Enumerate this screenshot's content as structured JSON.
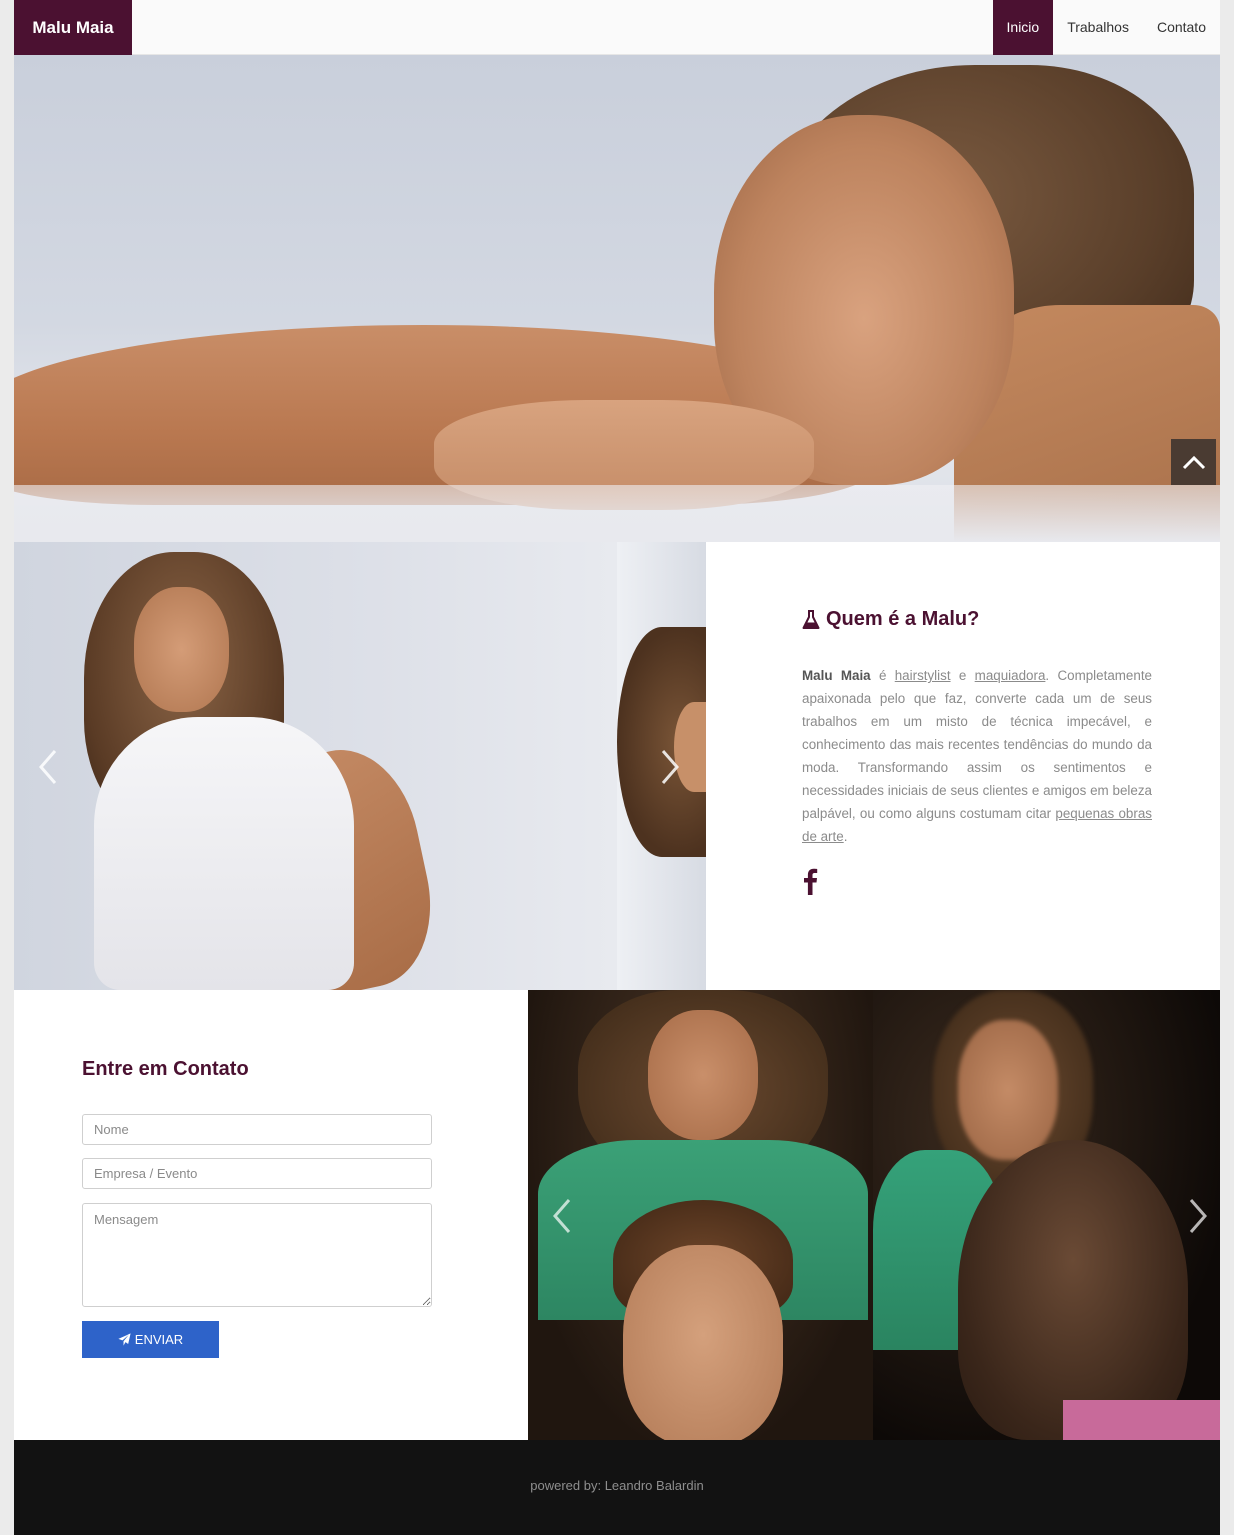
{
  "nav": {
    "brand": "Malu Maia",
    "links": [
      {
        "label": "Inicio",
        "active": true
      },
      {
        "label": "Trabalhos",
        "active": false
      },
      {
        "label": "Contato",
        "active": false
      }
    ]
  },
  "hero": {
    "scroll_top_icon": "chevron-up-icon"
  },
  "about": {
    "title": "Quem é a Malu?",
    "title_icon": "flask-icon",
    "name": "Malu Maia",
    "text_1": " é ",
    "link_hairstylist": "hairstylist",
    "text_2": " e ",
    "link_maquiadora": "maquiadora",
    "text_3": ". Completamente apaixonada pelo que faz, converte cada um de seus trabalhos em um misto de técnica impecável, e conhecimento das mais recentes tendências do mundo da moda. Transformando assim os sentimentos e necessidades iniciais de seus clientes e amigos em beleza palpável, ou como alguns costumam citar ",
    "link_obras": "pequenas obras de arte",
    "text_4": ".",
    "social_icon": "facebook-icon"
  },
  "contact": {
    "title": "Entre em Contato",
    "name_placeholder": "Nome",
    "company_placeholder": "Empresa / Evento",
    "message_placeholder": "Mensagem",
    "send_label": "ENVIAR",
    "send_icon": "paper-plane-icon"
  },
  "footer": {
    "text": "powered by: Leandro Balardin"
  },
  "colors": {
    "brand": "#4b1131",
    "button": "#2e63c9",
    "footer_bg": "#121212"
  }
}
